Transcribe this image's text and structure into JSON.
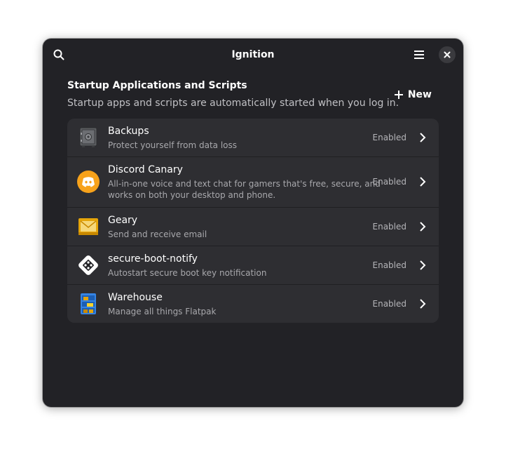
{
  "window": {
    "title": "Ignition"
  },
  "section": {
    "title": "Startup Applications and Scripts",
    "subtitle": "Startup apps and scripts are automatically started when you log in.",
    "new_label": "New"
  },
  "apps": [
    {
      "title": "Backups",
      "subtitle": "Protect yourself from data loss",
      "status": "Enabled",
      "icon": "safe-icon"
    },
    {
      "title": "Discord Canary",
      "subtitle_line1": "All-in-one voice and text chat for gamers that's free, secure, and",
      "subtitle_line2": "works on both your desktop and phone.",
      "status": "Enabled",
      "icon": "discord-icon"
    },
    {
      "title": "Geary",
      "subtitle": "Send and receive email",
      "status": "Enabled",
      "icon": "mail-icon"
    },
    {
      "title": "secure-boot-notify",
      "subtitle": "Autostart secure boot key notification",
      "status": "Enabled",
      "icon": "secure-boot-icon"
    },
    {
      "title": "Warehouse",
      "subtitle": "Manage all things Flatpak",
      "status": "Enabled",
      "icon": "warehouse-icon"
    }
  ],
  "colors": {
    "window_bg": "#222226",
    "list_bg": "#2e2e32",
    "accent_discord": "#f7a21b"
  }
}
